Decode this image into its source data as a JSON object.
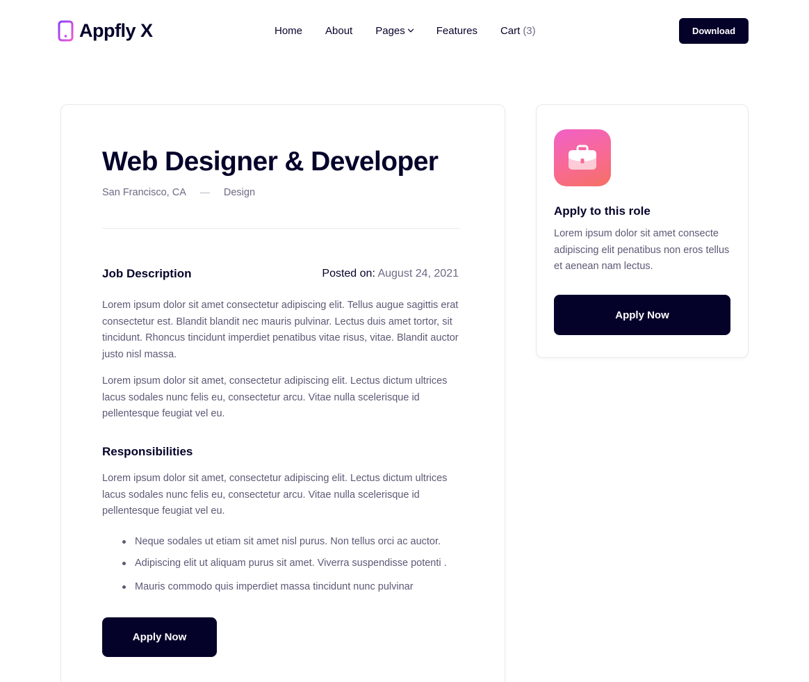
{
  "header": {
    "logo_text": "Appfly X",
    "logo_icon": "phone-icon",
    "nav": {
      "home": "Home",
      "about": "About",
      "pages": "Pages",
      "features": "Features",
      "cart": "Cart",
      "cart_count": "(3)"
    },
    "download_label": "Download"
  },
  "job": {
    "title": "Web Designer & Developer",
    "location": "San Francisco, CA",
    "department": "Design",
    "description_heading": "Job Description",
    "posted_label": "Posted on:",
    "posted_date": "August 24, 2021",
    "description_paragraphs": [
      "Lorem ipsum dolor sit amet consectetur adipiscing elit. Tellus augue sagittis erat consectetur est. Blandit blandit nec mauris pulvinar. Lectus duis amet tortor, sit tincidunt. Rhoncus tincidunt imperdiet penatibus vitae risus, vitae. Blandit auctor justo nisl massa.",
      "Lorem ipsum dolor sit amet, consectetur adipiscing elit. Lectus dictum ultrices lacus sodales nunc felis eu, consectetur arcu. Vitae nulla scelerisque id pellentesque feugiat vel eu."
    ],
    "responsibilities_heading": "Responsibilities",
    "responsibilities_paragraph": "Lorem ipsum dolor sit amet, consectetur adipiscing elit. Lectus dictum ultrices lacus sodales nunc felis eu, consectetur arcu. Vitae nulla scelerisque id pellentesque feugiat vel eu.",
    "responsibilities": [
      "Neque sodales ut etiam sit amet nisl purus. Non tellus orci ac auctor.",
      "Adipiscing elit ut aliquam purus sit amet. Viverra suspendisse potenti .",
      "Mauris commodo quis imperdiet massa tincidunt nunc pulvinar"
    ],
    "apply_label": "Apply Now"
  },
  "sidebar": {
    "icon": "briefcase-icon",
    "title": "Apply to this role",
    "text": "Lorem ipsum dolor sit amet consecte adipiscing elit penatibus non eros tellus et aenean nam lectus.",
    "apply_label": "Apply Now"
  },
  "colors": {
    "primary": "#05022a",
    "muted_text": "#5c5975",
    "border": "#e9e9ef",
    "logo_gradient_start": "#8a3ffc",
    "logo_gradient_end": "#ee5bd0",
    "icon_gradient_start": "#f060c8",
    "icon_gradient_end": "#f57063"
  }
}
